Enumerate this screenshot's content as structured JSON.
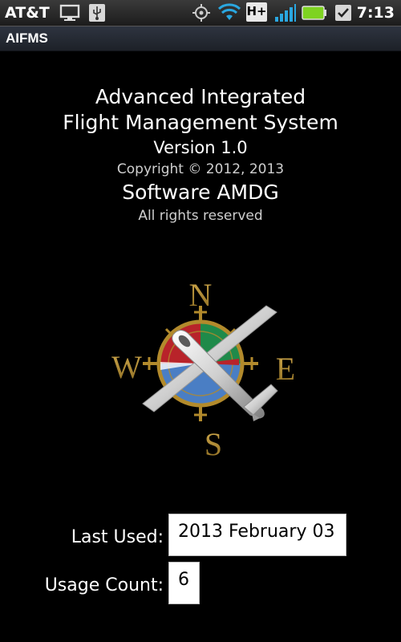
{
  "status_bar": {
    "carrier": "AT&T",
    "network_type": "H+",
    "time": "7:13",
    "icons": [
      "monitor-icon",
      "usb-icon",
      "gps-icon",
      "wifi-icon",
      "network-hplus-icon",
      "signal-icon",
      "battery-icon",
      "checkbox-icon"
    ]
  },
  "app": {
    "title": "AIFMS"
  },
  "about": {
    "line1": "Advanced Integrated",
    "line2": "Flight Management System",
    "version": "Version 1.0",
    "copyright": "Copyright © 2012, 2013",
    "company": "Software AMDG",
    "rights": "All rights reserved"
  },
  "logo": {
    "compass_letters": {
      "north": "N",
      "south": "S",
      "east": "E",
      "west": "W"
    },
    "colors": {
      "gold": "#b28a2c",
      "green": "#1f8a4a",
      "blue": "#4a7ec4",
      "red": "#b8232a"
    }
  },
  "fields": {
    "last_used": {
      "label": "Last Used:",
      "value": "2013 February 03"
    },
    "usage_count": {
      "label": "Usage Count:",
      "value": "6"
    }
  }
}
